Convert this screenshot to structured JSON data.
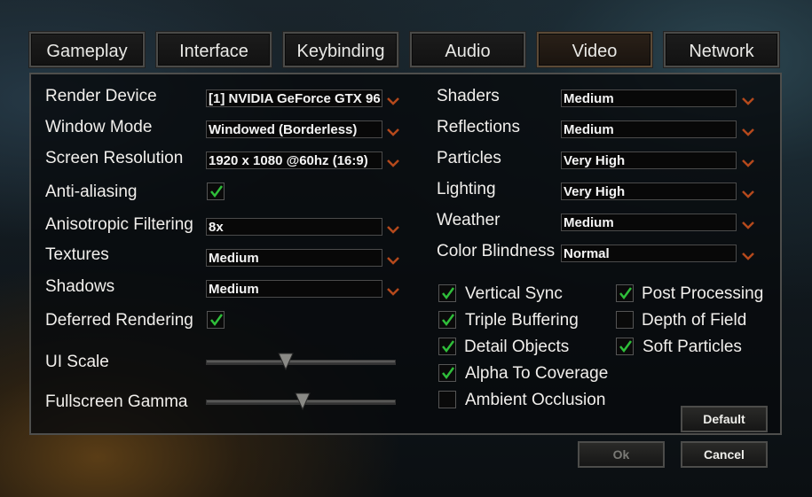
{
  "tabs": [
    {
      "label": "Gameplay"
    },
    {
      "label": "Interface"
    },
    {
      "label": "Keybinding"
    },
    {
      "label": "Audio"
    },
    {
      "label": "Video"
    },
    {
      "label": "Network"
    }
  ],
  "active_tab": "Video",
  "left": {
    "render_device": {
      "label": "Render Device",
      "value": "[1] NVIDIA GeForce GTX 96"
    },
    "window_mode": {
      "label": "Window Mode",
      "value": "Windowed (Borderless)"
    },
    "screen_resolution": {
      "label": "Screen Resolution",
      "value": "1920 x 1080 @60hz (16:9)"
    },
    "anti_aliasing": {
      "label": "Anti-aliasing",
      "checked": true
    },
    "anisotropic": {
      "label": "Anisotropic Filtering",
      "value": "8x"
    },
    "textures": {
      "label": "Textures",
      "value": "Medium"
    },
    "shadows": {
      "label": "Shadows",
      "value": "Medium"
    },
    "deferred": {
      "label": "Deferred Rendering",
      "checked": true
    },
    "ui_scale": {
      "label": "UI Scale",
      "value": 0.42
    },
    "gamma": {
      "label": "Fullscreen Gamma",
      "value": 0.51
    }
  },
  "right": {
    "shaders": {
      "label": "Shaders",
      "value": "Medium"
    },
    "reflections": {
      "label": "Reflections",
      "value": "Medium"
    },
    "particles": {
      "label": "Particles",
      "value": "Very High"
    },
    "lighting": {
      "label": "Lighting",
      "value": "Very High"
    },
    "weather": {
      "label": "Weather",
      "value": "Medium"
    },
    "color_blindness": {
      "label": "Color Blindness",
      "value": "Normal"
    }
  },
  "checkboxes": {
    "vertical_sync": {
      "label": "Vertical Sync",
      "checked": true
    },
    "triple_buffering": {
      "label": "Triple Buffering",
      "checked": true
    },
    "detail_objects": {
      "label": "Detail Objects",
      "checked": true
    },
    "alpha_to_coverage": {
      "label": "Alpha To Coverage",
      "checked": true
    },
    "ambient_occlusion": {
      "label": "Ambient Occlusion",
      "checked": false
    },
    "post_processing": {
      "label": "Post Processing",
      "checked": true
    },
    "depth_of_field": {
      "label": "Depth of Field",
      "checked": false
    },
    "soft_particles": {
      "label": "Soft Particles",
      "checked": true
    }
  },
  "buttons": {
    "default": "Default",
    "ok": "Ok",
    "cancel": "Cancel"
  },
  "colors": {
    "accent": "#b5491c",
    "check": "#2fbf3a"
  },
  "icons": {
    "dropdown": "chevron-down-icon",
    "check": "checkmark-icon",
    "slider": "slider-thumb-icon"
  }
}
